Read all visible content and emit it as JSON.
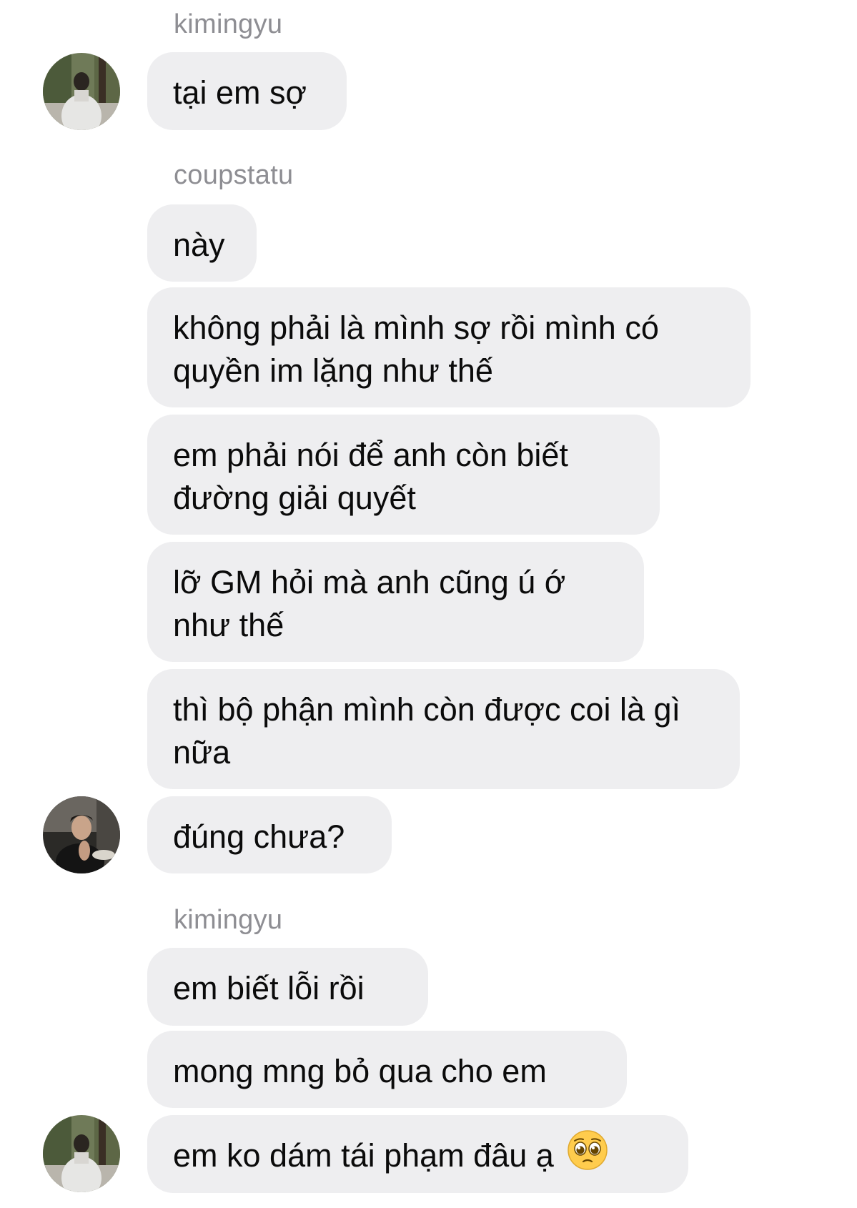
{
  "messages": [
    {
      "sender": "kimingyu"
    },
    {
      "text": "tại em sợ"
    },
    {
      "sender": "coupstatu"
    },
    {
      "text": "này"
    },
    {
      "text": "không phải là mình sợ rồi mình có quyền im lặng như thế"
    },
    {
      "text": "em phải nói để anh còn biết đường giải quyết"
    },
    {
      "text": "lỡ GM hỏi mà anh cũng ú ớ như thế"
    },
    {
      "text": "thì bộ phận mình còn được coi là gì nữa"
    },
    {
      "text": "đúng chưa?"
    },
    {
      "sender": "kimingyu"
    },
    {
      "text": "em biết lỗi rồi"
    },
    {
      "text": "mong mng bỏ qua cho em"
    },
    {
      "text": "em ko dám tái phạm đâu ạ",
      "emoji": "pleading-face"
    }
  ],
  "colors": {
    "bubble_bg": "#eeeef0",
    "sender_text": "#8e8e93",
    "message_text": "#0b0b0b"
  },
  "icons": [
    "avatar-kimingyu",
    "avatar-coupstatu",
    "pleading-face-emoji"
  ]
}
